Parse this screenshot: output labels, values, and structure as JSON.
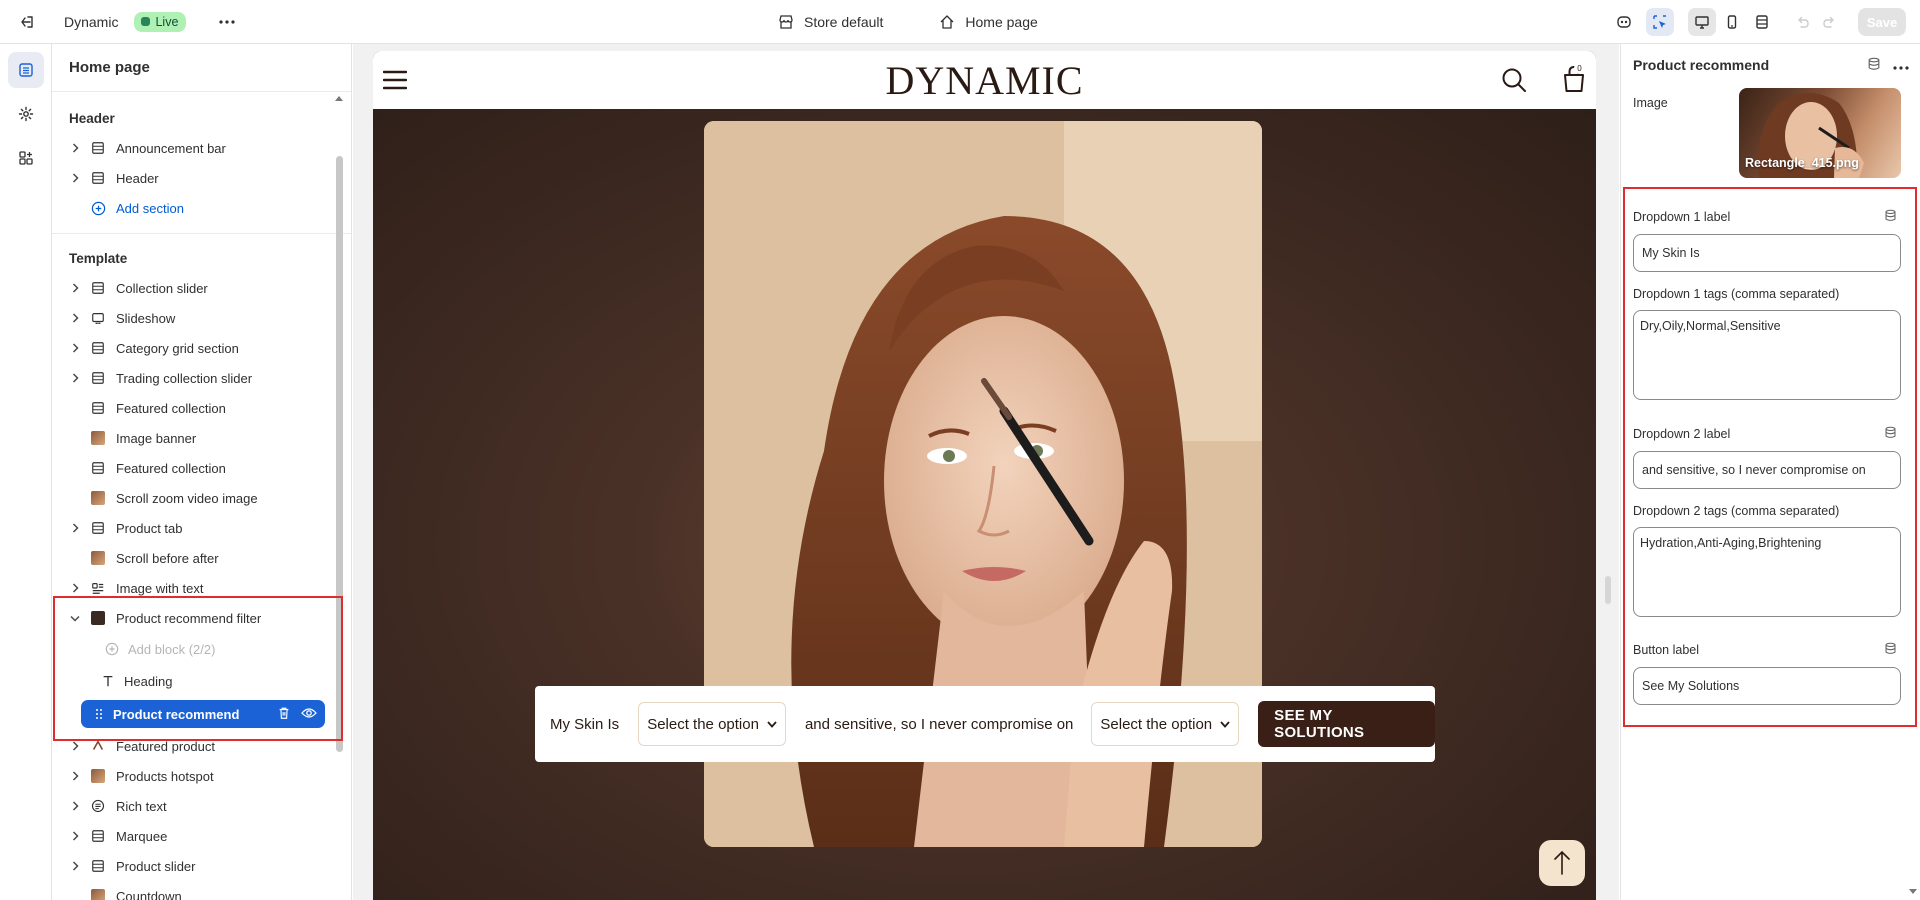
{
  "topbar": {
    "theme_name": "Dynamic",
    "status_badge": "Live",
    "store_label": "Store default",
    "page_label": "Home page",
    "save_label": "Save"
  },
  "sidebar": {
    "title": "Home page",
    "header_group": "Header",
    "header_items": [
      {
        "label": "Announcement bar",
        "icon": "section-icon"
      },
      {
        "label": "Header",
        "icon": "section-icon"
      }
    ],
    "add_section": "Add section",
    "template_group": "Template",
    "template_items": [
      {
        "label": "Collection slider",
        "icon": "section-icon",
        "expandable": true
      },
      {
        "label": "Slideshow",
        "icon": "slideshow-icon",
        "expandable": true
      },
      {
        "label": "Category grid section",
        "icon": "section-icon",
        "expandable": true
      },
      {
        "label": "Trading collection slider",
        "icon": "section-icon",
        "expandable": true
      },
      {
        "label": "Featured collection",
        "icon": "section-icon",
        "expandable": false
      },
      {
        "label": "Image banner",
        "icon": "image-thumbnail",
        "expandable": false
      },
      {
        "label": "Featured collection",
        "icon": "section-icon",
        "expandable": false
      },
      {
        "label": "Scroll zoom video image",
        "icon": "image-thumbnail",
        "expandable": false
      },
      {
        "label": "Product tab",
        "icon": "section-icon",
        "expandable": true
      },
      {
        "label": "Scroll before after",
        "icon": "image-thumbnail",
        "expandable": false
      },
      {
        "label": "Image with text",
        "icon": "image-text-icon",
        "expandable": true
      },
      {
        "label": "Product recommend filter",
        "icon": "image-thumbnail-dark",
        "expandable": true,
        "expanded": true
      }
    ],
    "children": {
      "add_block": "Add block (2/2)",
      "heading": "Heading",
      "selected": "Product recommend"
    },
    "after_items": [
      {
        "label": "Featured product",
        "icon": "product-icon",
        "expandable": true
      },
      {
        "label": "Products hotspot",
        "icon": "image-thumbnail",
        "expandable": true
      },
      {
        "label": "Rich text",
        "icon": "rich-text-icon",
        "expandable": true
      },
      {
        "label": "Marquee",
        "icon": "section-icon",
        "expandable": true
      },
      {
        "label": "Product slider",
        "icon": "section-icon",
        "expandable": true
      },
      {
        "label": "Countdown",
        "icon": "image-thumbnail",
        "expandable": false
      }
    ]
  },
  "preview": {
    "logo": "DYNAMIC",
    "cart_count": "0",
    "filter_text_1": "My Skin Is",
    "select_1": "Select the option",
    "filter_text_2": "and sensitive, so I never compromise on",
    "select_2": "Select the option",
    "button": "SEE MY SOLUTIONS"
  },
  "rpanel": {
    "title": "Product recommend",
    "image_label": "Image",
    "image_name": "Rectangle_415.png",
    "dropdown1_label_title": "Dropdown 1 label",
    "dropdown1_label_value": "My Skin Is",
    "dropdown1_tags_title": "Dropdown 1 tags (comma separated)",
    "dropdown1_tags_value": "Dry,Oily,Normal,Sensitive",
    "dropdown2_label_title": "Dropdown 2 label",
    "dropdown2_label_value": "and sensitive, so I never compromise on",
    "dropdown2_tags_title": "Dropdown 2 tags (comma separated)",
    "dropdown2_tags_value": "Hydration,Anti-Aging,Brightening",
    "button_label_title": "Button label",
    "button_label_value": "See My Solutions"
  },
  "colors": {
    "accent": "#1a62d6",
    "highlight_box": "#e02c2c",
    "live_badge": "#aff0b5",
    "store_button": "#3a1f17"
  }
}
